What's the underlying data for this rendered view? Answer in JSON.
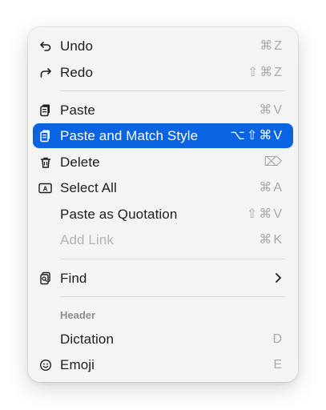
{
  "menu": {
    "items": [
      {
        "label": "Undo",
        "shortcut": "⌘Z",
        "icon": "undo-icon"
      },
      {
        "label": "Redo",
        "shortcut": "⇧⌘Z",
        "icon": "redo-icon"
      },
      {
        "label": "Paste",
        "shortcut": "⌘V",
        "icon": "paste-icon"
      },
      {
        "label": "Paste and Match Style",
        "shortcut": "⌥⇧⌘V",
        "icon": "paste-icon",
        "highlighted": true
      },
      {
        "label": "Delete",
        "shortcut": "⌦",
        "icon": "trash-icon"
      },
      {
        "label": "Select All",
        "shortcut": "⌘A",
        "icon": "select-all-icon"
      },
      {
        "label": "Paste as Quotation",
        "shortcut": "⇧⌘V"
      },
      {
        "label": "Add Link",
        "shortcut": "⌘K",
        "disabled": true
      },
      {
        "label": "Find",
        "icon": "find-icon",
        "submenu": true
      },
      {
        "label": "Dictation",
        "shortcut": "D"
      },
      {
        "label": "Emoji",
        "shortcut": "E",
        "icon": "smiley-icon"
      }
    ],
    "section_header": "Header"
  },
  "colors": {
    "highlight": "#0a63e0",
    "menu_bg": "#f4f4f4",
    "text": "#1d1d1f",
    "shortcut": "#a9a9a9",
    "disabled": "#b3b3b3"
  }
}
